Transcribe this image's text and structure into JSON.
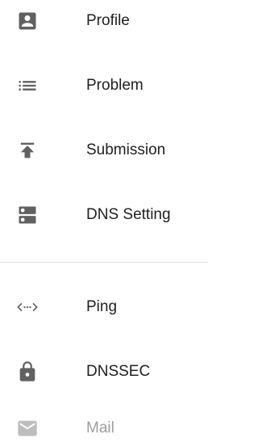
{
  "nav": {
    "items": [
      {
        "label": "Profile",
        "icon": "account-box-icon"
      },
      {
        "label": "Problem",
        "icon": "list-icon"
      },
      {
        "label": "Submission",
        "icon": "publish-icon"
      },
      {
        "label": "DNS Setting",
        "icon": "dns-icon"
      },
      {
        "label": "Ping",
        "icon": "code-dots-icon"
      },
      {
        "label": "DNSSEC",
        "icon": "lock-icon"
      },
      {
        "label": "Mail",
        "icon": "mail-icon",
        "disabled": true
      }
    ]
  },
  "colors": {
    "icon": "#616161",
    "text": "#212121",
    "disabled": "#9e9e9e",
    "divider": "#e0e0e0"
  }
}
